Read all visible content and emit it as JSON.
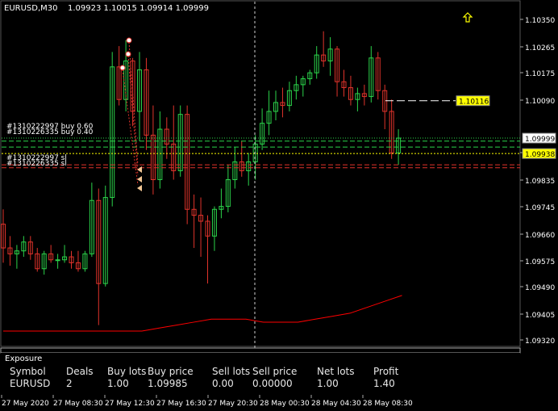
{
  "header": {
    "symbol": "EURUSD,M30",
    "ohlc": "1.09923 1.10015 1.09914 1.09999"
  },
  "colors": {
    "bg": "#000000",
    "bull": "#2bd34a",
    "bear": "#e0332b",
    "grid": "#404040",
    "bid_line": "#2bd34a",
    "ask_line": "#ffff00",
    "equity": "#ff0000"
  },
  "price_axis": {
    "ticks": [
      "1.10350",
      "1.10265",
      "1.10175",
      "1.10090",
      "1.09920",
      "1.09835",
      "1.09745",
      "1.09660",
      "1.09575",
      "1.09490",
      "1.09405",
      "1.09320"
    ],
    "bid_label": "1.09999",
    "ask_label": "1.09938",
    "alert_label": "1.10116"
  },
  "time_axis": {
    "ticks": [
      "27 May 2020",
      "27 May 08:30",
      "27 May 12:30",
      "27 May 16:30",
      "27 May 20:30",
      "28 May 00:30",
      "28 May 04:30",
      "28 May 08:30"
    ]
  },
  "trade_labels": {
    "buy1": "#1310222997 buy 0.60",
    "buy2": "#1310226335 buy 0.40",
    "sl1": "#1310222997 sl",
    "sl2": "#1310226335 sl"
  },
  "chart_data": {
    "type": "candlestick",
    "symbol": "EURUSD",
    "timeframe": "M30",
    "ylim": [
      1.0931,
      1.1039
    ],
    "candles": [
      [
        1.097,
        1.0975,
        1.0957,
        1.0962
      ],
      [
        1.0962,
        1.0966,
        1.0956,
        1.096
      ],
      [
        1.096,
        1.0963,
        1.0955,
        1.0961
      ],
      [
        1.0961,
        1.0966,
        1.0959,
        1.0964
      ],
      [
        1.0964,
        1.0966,
        1.0958,
        1.096
      ],
      [
        1.096,
        1.0962,
        1.0954,
        1.0955
      ],
      [
        1.0955,
        1.0961,
        1.0953,
        1.096
      ],
      [
        1.096,
        1.0963,
        1.0957,
        1.0958
      ],
      [
        1.0958,
        1.096,
        1.0955,
        1.0958
      ],
      [
        1.0958,
        1.0963,
        1.0957,
        1.0959
      ],
      [
        1.0959,
        1.0961,
        1.0955,
        1.0957
      ],
      [
        1.0957,
        1.0961,
        1.0954,
        1.0955
      ],
      [
        1.0955,
        1.0961,
        1.0954,
        1.096
      ],
      [
        1.096,
        1.0984,
        1.0959,
        1.0978
      ],
      [
        1.0978,
        1.0982,
        1.0936,
        1.095
      ],
      [
        1.095,
        1.0983,
        1.0949,
        1.0979
      ],
      [
        1.0979,
        1.1028,
        1.0976,
        1.1023
      ],
      [
        1.1023,
        1.103,
        1.101,
        1.1012
      ],
      [
        1.1012,
        1.1032,
        1.1008,
        1.1025
      ],
      [
        1.1025,
        1.1026,
        1.1003,
        1.1008
      ],
      [
        1.1008,
        1.1028,
        1.0998,
        1.1022
      ],
      [
        1.1022,
        1.1026,
        1.0995,
        1.1
      ],
      [
        1.1,
        1.101,
        1.098,
        1.0985
      ],
      [
        1.0985,
        1.1008,
        1.0982,
        1.1002
      ],
      [
        1.1002,
        1.1006,
        1.0992,
        1.0997
      ],
      [
        1.0997,
        1.101,
        1.0985,
        1.0988
      ],
      [
        1.0988,
        1.101,
        1.0986,
        1.1007
      ],
      [
        1.1007,
        1.101,
        1.097,
        1.0975
      ],
      [
        1.0975,
        1.098,
        1.0962,
        1.0973
      ],
      [
        1.0973,
        1.0979,
        1.0959,
        1.0971
      ],
      [
        1.0971,
        1.0973,
        1.095,
        1.0966
      ],
      [
        1.0966,
        1.0976,
        1.0961,
        1.0975
      ],
      [
        1.0975,
        1.0982,
        1.0972,
        1.0976
      ],
      [
        1.0976,
        1.099,
        1.0974,
        1.0985
      ],
      [
        1.0985,
        1.0996,
        1.0982,
        1.0991
      ],
      [
        1.0991,
        1.0998,
        1.0986,
        1.0988
      ],
      [
        1.0988,
        1.0994,
        1.0983,
        1.0991
      ],
      [
        1.0991,
        1.1,
        1.0985,
        1.0997
      ],
      [
        1.0997,
        1.1009,
        1.0995,
        1.1004
      ],
      [
        1.1004,
        1.1015,
        1.1,
        1.1008
      ],
      [
        1.1008,
        1.1015,
        1.1005,
        1.1011
      ],
      [
        1.1011,
        1.1016,
        1.1006,
        1.101
      ],
      [
        1.101,
        1.1018,
        1.1008,
        1.1015
      ],
      [
        1.1015,
        1.102,
        1.1012,
        1.1017
      ],
      [
        1.1017,
        1.102,
        1.1013,
        1.1019
      ],
      [
        1.1019,
        1.1022,
        1.1017,
        1.1021
      ],
      [
        1.1021,
        1.103,
        1.1019,
        1.1027
      ],
      [
        1.1027,
        1.1035,
        1.1023,
        1.1025
      ],
      [
        1.1025,
        1.1033,
        1.102,
        1.1029
      ],
      [
        1.1029,
        1.103,
        1.1013,
        1.1018
      ],
      [
        1.1018,
        1.1022,
        1.1013,
        1.1016
      ],
      [
        1.1016,
        1.102,
        1.101,
        1.1012
      ],
      [
        1.1012,
        1.1016,
        1.1008,
        1.1014
      ],
      [
        1.1014,
        1.1017,
        1.101,
        1.1013
      ],
      [
        1.1013,
        1.103,
        1.1011,
        1.1026
      ],
      [
        1.1026,
        1.1028,
        1.1012,
        1.1015
      ],
      [
        1.1015,
        1.1017,
        1.1002,
        1.1008
      ],
      [
        1.1008,
        1.1012,
        1.0992,
        1.0994
      ],
      [
        1.0994,
        1.1002,
        1.099,
        1.0999
      ]
    ],
    "equity_curve": [
      1.0934,
      1.0934,
      1.0934,
      1.0934,
      1.0934,
      1.0934,
      1.0934,
      1.0934,
      1.0934,
      1.0935,
      1.0936,
      1.0937,
      1.0938,
      1.0938,
      1.0938,
      1.0937,
      1.0937,
      1.0937,
      1.0938,
      1.0939,
      1.094,
      1.0942,
      1.0944,
      1.0946
    ],
    "lines": {
      "bid": 1.0999,
      "ask": 1.09938,
      "alert": 1.10116,
      "entry1": 1.0998,
      "entry2": 1.0996,
      "sl1": 1.099,
      "sl2": 1.0989
    }
  },
  "exposure": {
    "title": "Exposure",
    "columns": [
      "Symbol",
      "Deals",
      "Buy lots",
      "Buy price",
      "Sell lots",
      "Sell price",
      "Net lots",
      "Profit"
    ],
    "rows": [
      [
        "EURUSD",
        "2",
        "1.00",
        "1.09985",
        "0.00",
        "0.00000",
        "1.00",
        "1.40"
      ]
    ]
  }
}
